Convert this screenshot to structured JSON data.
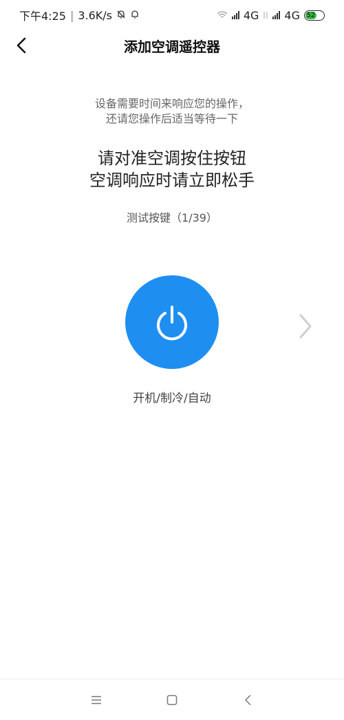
{
  "status_bar": {
    "time": "下午4:25",
    "net_speed": "3.6K/s",
    "network1": "4G",
    "network2": "4G",
    "battery": "52"
  },
  "header": {
    "title": "添加空调遥控器",
    "back_icon": "chevron-left-icon"
  },
  "content": {
    "hint_line1": "设备需要时间来响应您的操作，",
    "hint_line2": "还请您操作后适当等待一下",
    "instruction_line1": "请对准空调按住按钮",
    "instruction_line2": "空调响应时请立即松手",
    "progress": "测试按键（1/39）",
    "key_label": "开机/制冷/自动",
    "power_icon": "power-icon",
    "next_icon": "chevron-right-icon",
    "accent_color": "#1e8ff0"
  },
  "nav": {
    "menu_icon": "menu-icon",
    "home_icon": "home-square-icon",
    "back_icon": "back-triangle-icon"
  }
}
